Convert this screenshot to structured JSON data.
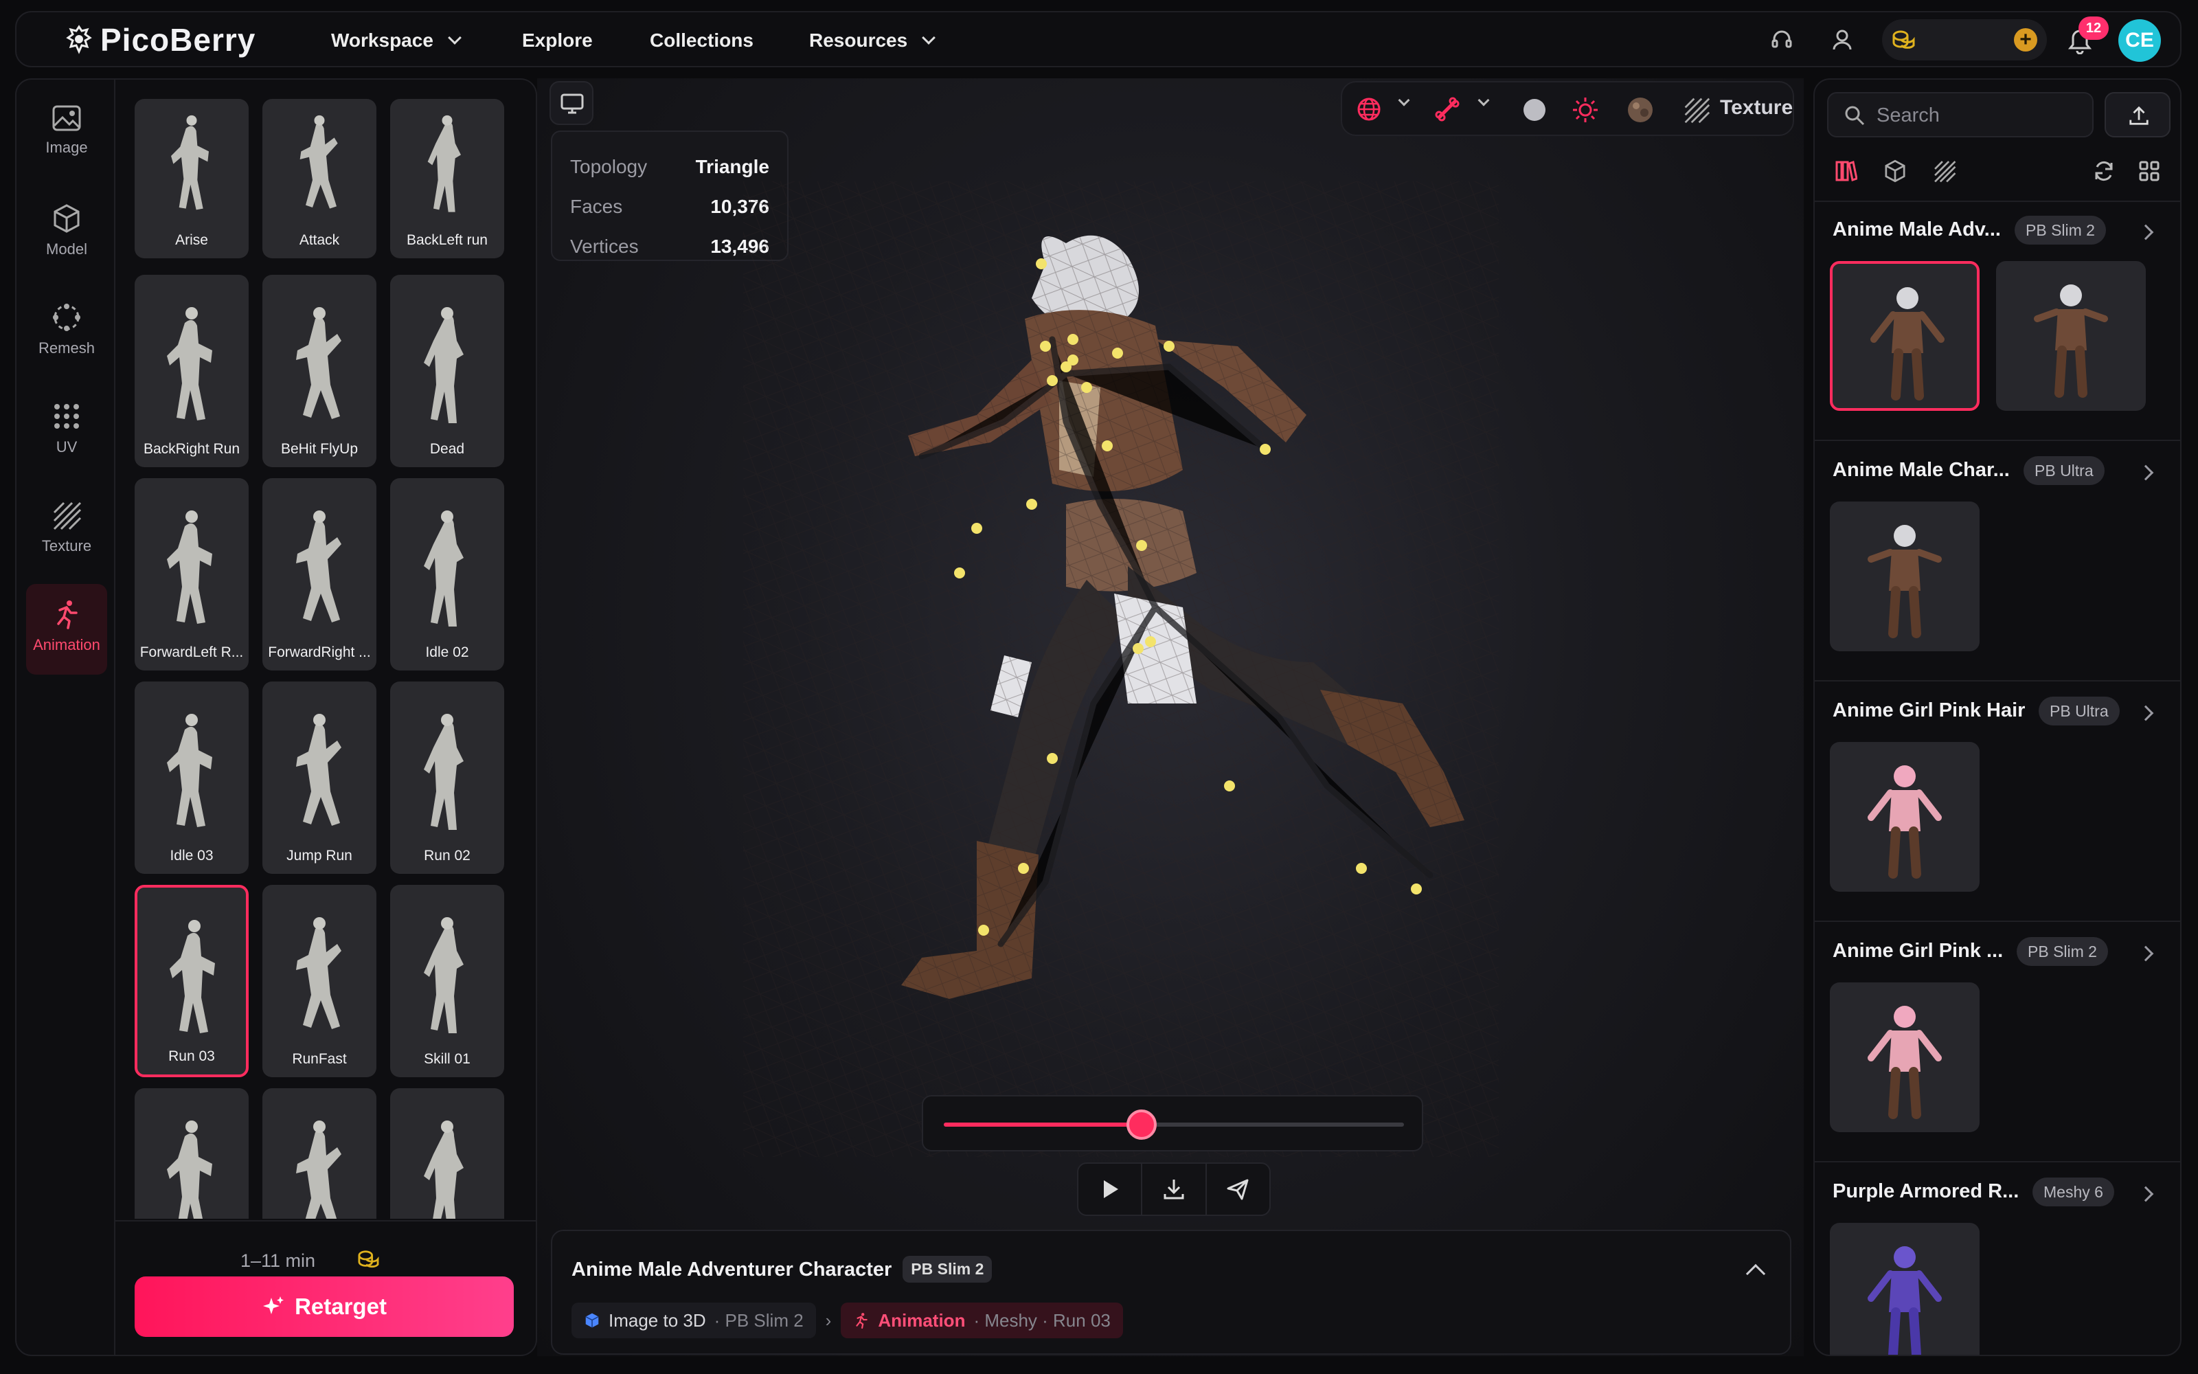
{
  "app": {
    "name": "PicoBerry"
  },
  "nav": {
    "workspace": "Workspace",
    "explore": "Explore",
    "collections": "Collections",
    "resources": "Resources"
  },
  "notifications": {
    "count": "12"
  },
  "user": {
    "initials": "CE"
  },
  "tools": [
    {
      "label": "Image",
      "icon": "image-icon"
    },
    {
      "label": "Model",
      "icon": "cube-icon"
    },
    {
      "label": "Remesh",
      "icon": "remesh-icon"
    },
    {
      "label": "UV",
      "icon": "uv-grid-icon"
    },
    {
      "label": "Texture",
      "icon": "texture-icon"
    },
    {
      "label": "Animation",
      "icon": "running-figure-icon",
      "active": true
    }
  ],
  "animations": [
    {
      "label": "Arise"
    },
    {
      "label": "Attack"
    },
    {
      "label": "BackLeft run"
    },
    {
      "label": "BackRight Run"
    },
    {
      "label": "BeHit FlyUp"
    },
    {
      "label": "Dead"
    },
    {
      "label": "ForwardLeft R..."
    },
    {
      "label": "ForwardRight ..."
    },
    {
      "label": "Idle 02"
    },
    {
      "label": "Idle 03"
    },
    {
      "label": "Jump Run"
    },
    {
      "label": "Run 02"
    },
    {
      "label": "Run 03",
      "selected": true
    },
    {
      "label": "RunFast"
    },
    {
      "label": "Skill 01"
    },
    {
      "label": ""
    },
    {
      "label": ""
    },
    {
      "label": ""
    }
  ],
  "footer": {
    "duration": "1–11 min",
    "retarget_label": "Retarget"
  },
  "stats": {
    "topology_label": "Topology",
    "topology": "Triangle",
    "faces_label": "Faces",
    "faces": "10,376",
    "vertices_label": "Vertices",
    "vertices": "13,496"
  },
  "viewport_toolbar": {
    "texture_label": "Texture"
  },
  "playback": {
    "progress": 0.43
  },
  "model_info": {
    "title": "Anime Male Adventurer Character",
    "model_tag": "PB Slim 2",
    "source": {
      "label": "Image to 3D",
      "detail": "· PB Slim 2"
    },
    "current": {
      "label": "Animation",
      "detail": "· Meshy · Run 03"
    }
  },
  "search": {
    "placeholder": "Search"
  },
  "library": [
    {
      "title": "Anime Male Adv...",
      "tag": "PB Slim 2",
      "thumbs": 2
    },
    {
      "title": "Anime Male Char...",
      "tag": "PB Ultra",
      "thumbs": 1
    },
    {
      "title": "Anime Girl Pink Hair",
      "tag": "PB Ultra",
      "thumbs": 1
    },
    {
      "title": "Anime Girl Pink ...",
      "tag": "PB Slim 2",
      "thumbs": 1
    },
    {
      "title": "Purple Armored R...",
      "tag": "Meshy 6",
      "thumbs": 1
    }
  ],
  "colors": {
    "accent": "#ff2c5e",
    "credit": "#d99a21",
    "avatar": "#21c4d8"
  }
}
